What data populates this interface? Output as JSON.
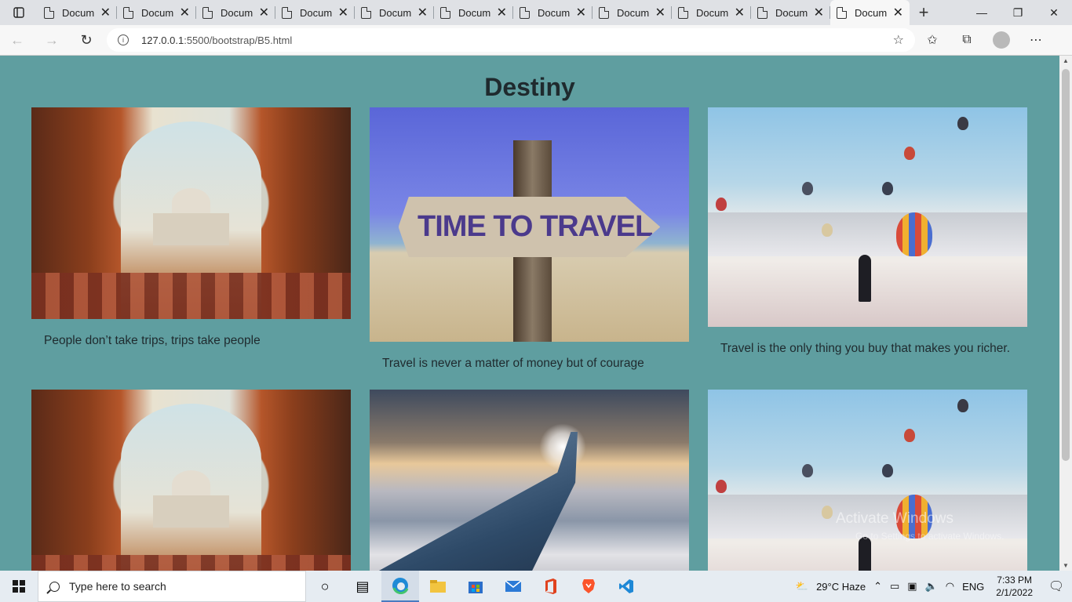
{
  "browser": {
    "tabs": [
      {
        "title": "Docum"
      },
      {
        "title": "Docum"
      },
      {
        "title": "Docum"
      },
      {
        "title": "Docum"
      },
      {
        "title": "Docum"
      },
      {
        "title": "Docum"
      },
      {
        "title": "Docum"
      },
      {
        "title": "Docum"
      },
      {
        "title": "Docum"
      },
      {
        "title": "Docum"
      },
      {
        "title": "Docum",
        "active": true
      }
    ],
    "url_host": "127.0.0.1",
    "url_path": ":5500/bootstrap/B5.html"
  },
  "page": {
    "title": "Destiny",
    "cards": [
      {
        "caption": "People don’t take trips, trips take people",
        "image": "taj-mahal-arch"
      },
      {
        "caption": "Travel is never a matter of money but of courage",
        "image": "time-to-travel-sign",
        "sign_text": "TIME TO TRAVEL"
      },
      {
        "caption": "Travel is the only thing you buy that makes you richer.",
        "image": "hot-air-balloons"
      },
      {
        "caption": "",
        "image": "taj-mahal-arch"
      },
      {
        "caption": "",
        "image": "airplane-wing"
      },
      {
        "caption": "",
        "image": "hot-air-balloons"
      }
    ]
  },
  "watermark": {
    "line1": "Activate Windows",
    "line2": "Go to Settings to activate Windows."
  },
  "taskbar": {
    "search_placeholder": "Type here to search",
    "weather": "29°C  Haze",
    "language": "ENG",
    "time": "7:33 PM",
    "date": "2/1/2022"
  }
}
